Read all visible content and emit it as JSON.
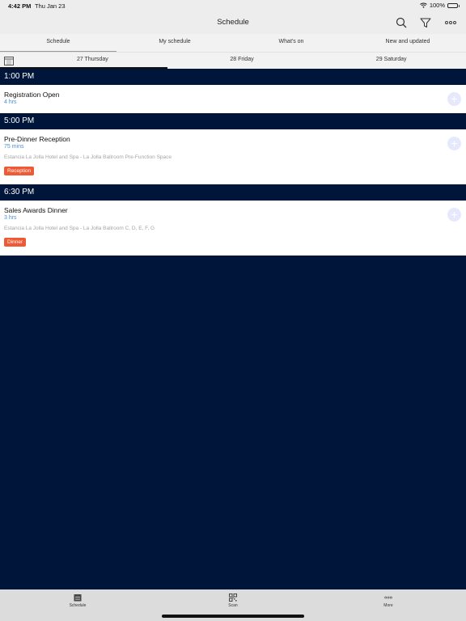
{
  "status": {
    "time": "4:42 PM",
    "date": "Thu Jan 23",
    "battery": "100%"
  },
  "nav": {
    "title": "Schedule"
  },
  "tabs": [
    {
      "label": "Schedule",
      "active": true
    },
    {
      "label": "My schedule",
      "active": false
    },
    {
      "label": "What's on",
      "active": false
    },
    {
      "label": "New and updated",
      "active": false
    }
  ],
  "days": [
    {
      "label": "27 Thursday",
      "active": true
    },
    {
      "label": "28 Friday",
      "active": false
    },
    {
      "label": "29 Saturday",
      "active": false
    }
  ],
  "sections": [
    {
      "time": "1:00 PM",
      "events": [
        {
          "title": "Registration Open",
          "duration": "4 hrs",
          "location": "",
          "tag": ""
        }
      ]
    },
    {
      "time": "5:00 PM",
      "events": [
        {
          "title": "Pre-Dinner Reception",
          "duration": "75 mins",
          "location": "Estancia La Jolla Hotel and Spa - La Jolla Ballroom Pre-Function Space",
          "tag": "Reception"
        }
      ]
    },
    {
      "time": "6:30 PM",
      "events": [
        {
          "title": "Sales Awards Dinner",
          "duration": "3 hrs",
          "location": "Estancia La Jolla Hotel and Spa - La Jolla Ballroom C, D, E, F, G",
          "tag": "Dinner"
        }
      ]
    }
  ],
  "bottom_tabs": [
    {
      "label": "Schedule",
      "icon": "calendar-icon"
    },
    {
      "label": "Scan",
      "icon": "qr-code-icon"
    },
    {
      "label": "More",
      "icon": "more-dots-icon"
    }
  ],
  "colors": {
    "header_bg": "#00153a",
    "accent": "#4a8fd6",
    "tag": "#ef5a36"
  }
}
